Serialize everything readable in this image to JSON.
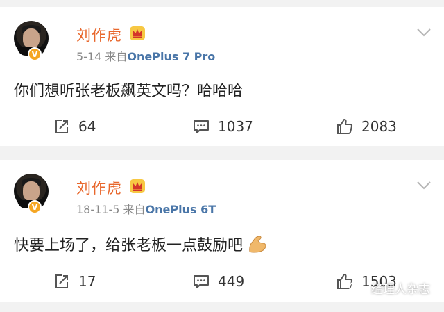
{
  "posts": [
    {
      "author": "刘作虎",
      "date": "5-14",
      "source_prefix": "来自",
      "source": "OnePlus 7 Pro",
      "text": "你们想听张老板飙英文吗？哈哈哈",
      "reposts": "64",
      "comments": "1037",
      "likes": "2083"
    },
    {
      "author": "刘作虎",
      "date": "18-11-5",
      "source_prefix": "来自",
      "source": "OnePlus 6T",
      "text": "快要上场了，给张老板一点鼓励吧",
      "reposts": "17",
      "comments": "449",
      "likes": "1503"
    }
  ],
  "verified_badge": "V",
  "watermark": "经理人杂志",
  "icons": {
    "crown": "crown-icon",
    "chevron": "chevron-down-icon",
    "repost": "repost-icon",
    "comment": "comment-icon",
    "like": "thumbs-up-icon",
    "emoji": "flexed-biceps-icon"
  },
  "colors": {
    "name": "#e8672c",
    "source": "#4a76a8",
    "badge": "#f5a623",
    "background": "#f2f2f2"
  }
}
